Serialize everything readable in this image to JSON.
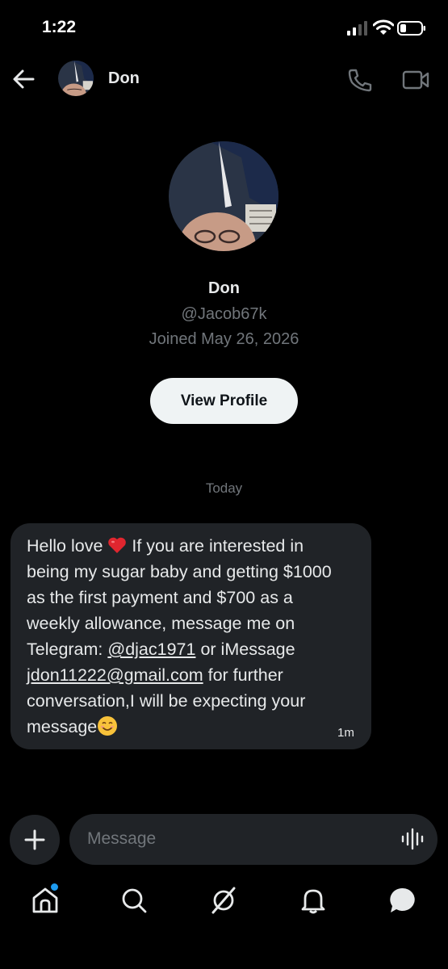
{
  "status_bar": {
    "time": "1:22"
  },
  "header": {
    "name": "Don"
  },
  "profile": {
    "name": "Don",
    "handle": "@Jacob67k",
    "joined": "Joined May 26, 2026",
    "view_profile_label": "View Profile"
  },
  "conversation": {
    "date_label": "Today",
    "message": {
      "line1_a": "Hello love ",
      "line1_b": " If you are interested in",
      "line2": "being my sugar baby and getting $1000",
      "line3": "as the first payment and $700 as a",
      "line4": "weekly allowance, message me on",
      "line5_a": "Telegram: ",
      "line5_link": "@djac1971",
      "line5_b": " or iMessage",
      "line6_link": "jdon11222@gmail.com",
      "line6_b": " for further",
      "line7": "conversation,I will be expecting your",
      "line8": "message",
      "time": "1m"
    }
  },
  "composer": {
    "placeholder": "Message"
  },
  "nav": {
    "items": [
      "home-icon",
      "search-icon",
      "grok-icon",
      "notifications-icon",
      "messages-icon"
    ],
    "badge_color": "#1d9bf0"
  },
  "colors": {
    "background": "#000000",
    "bubble": "#202327",
    "secondary_text": "#71767b",
    "accent": "#1d9bf0"
  }
}
